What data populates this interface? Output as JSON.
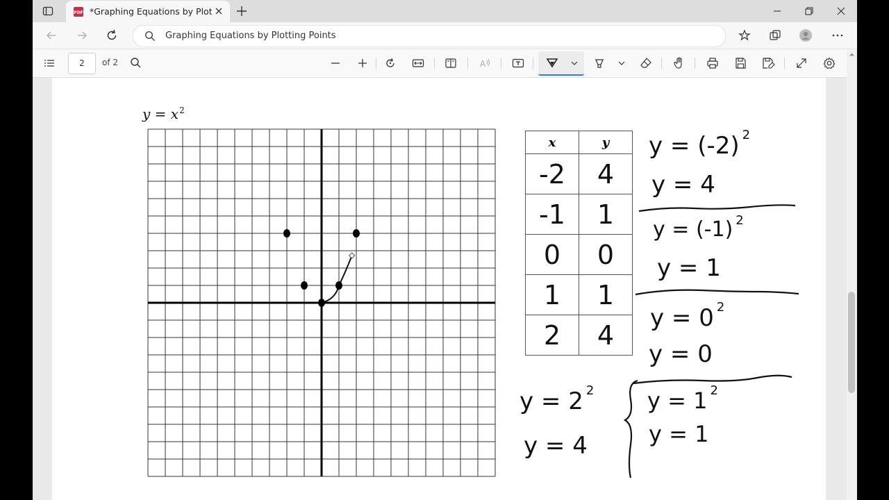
{
  "browser": {
    "tab_title": "*Graphing Equations by Plotting",
    "address": "Graphing Equations by Plotting Points"
  },
  "pdf_toolbar": {
    "page_number": "2",
    "page_of": "of 2"
  },
  "document": {
    "equation_label": "y = x",
    "equation_exponent": "2",
    "table": {
      "headers": [
        "x",
        "y"
      ],
      "rows": [
        [
          "-2",
          "4"
        ],
        [
          "-1",
          "1"
        ],
        [
          "0",
          "0"
        ],
        [
          "1",
          "1"
        ],
        [
          "2",
          "4"
        ]
      ]
    },
    "notes": [
      {
        "base": "y = (-2)",
        "exp": "2"
      },
      {
        "base": "y = 4",
        "exp": ""
      },
      {
        "base": "y = (-1)",
        "exp": "2"
      },
      {
        "base": "y = 1",
        "exp": ""
      },
      {
        "base": "y = 0",
        "exp": "2"
      },
      {
        "base": "y = 0",
        "exp": ""
      },
      {
        "base": "y = 1",
        "exp": "2"
      },
      {
        "base": "y = 1",
        "exp": ""
      },
      {
        "base": "y = 2",
        "exp": "2"
      },
      {
        "base": "y = 4",
        "exp": ""
      }
    ],
    "grid": {
      "x_range": [
        -10,
        10
      ],
      "y_range": [
        -10,
        10
      ],
      "plotted_points": [
        [
          -2,
          4
        ],
        [
          -1,
          1
        ],
        [
          0,
          0
        ],
        [
          1,
          1
        ],
        [
          2,
          4
        ]
      ]
    }
  },
  "colors": {
    "active_tool_underline": "#2b7fd8",
    "ink": "#111111"
  }
}
